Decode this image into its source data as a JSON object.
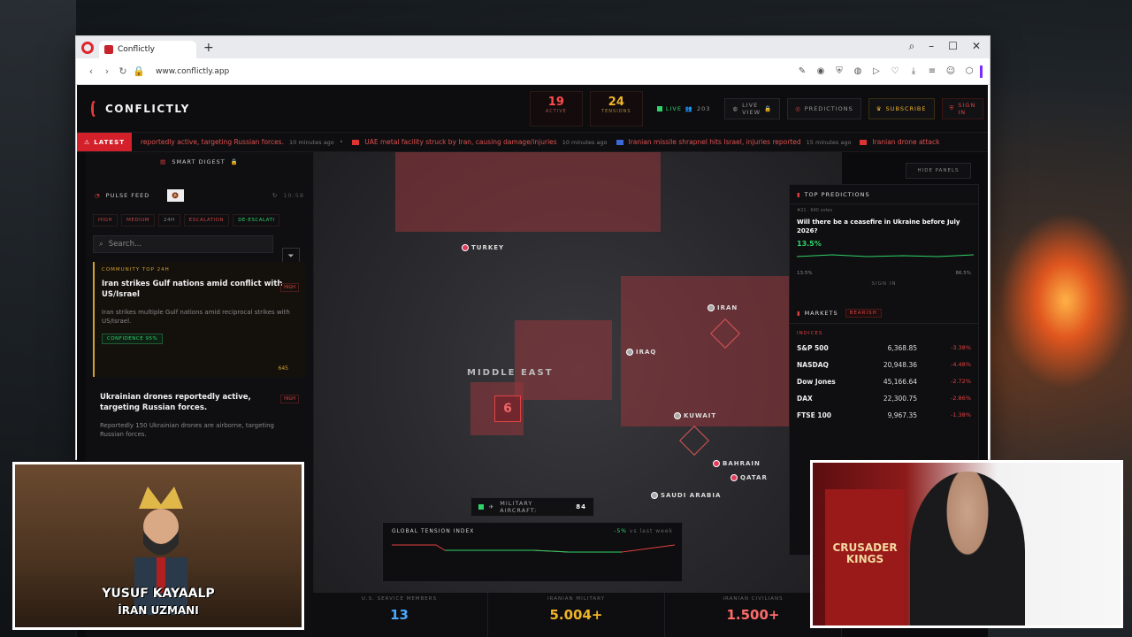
{
  "browser": {
    "tab_title": "Conflictly",
    "url": "www.conflictly.app"
  },
  "app": {
    "brand": "CONFLICTLY",
    "stats": [
      {
        "value": "19",
        "label": "ACTIVE"
      },
      {
        "value": "24",
        "label": "TENSIONS"
      }
    ],
    "live_label": "LIVE",
    "viewers": "203",
    "live_view_label": "LIVE VIEW",
    "predictions_label": "PREDICTIONS",
    "subscribe_label": "SUBSCRIBE",
    "sign_in_label": "SIGN IN"
  },
  "ticker": {
    "latest_label": "LATEST",
    "items": [
      {
        "text": "reportedly active, targeting Russian forces.",
        "time": "10 minutes ago"
      },
      {
        "text": "UAE metal facility struck by Iran, causing damage/injuries",
        "time": "10 minutes ago"
      },
      {
        "text": "Iranian missile shrapnel hits Israel, injuries reported",
        "time": "15 minutes ago"
      },
      {
        "text": "Iranian drone attack",
        "time": ""
      }
    ]
  },
  "left_panel": {
    "smart_digest": "SMART DIGEST",
    "pulse_feed": "PULSE FEED",
    "time": "10:58",
    "filters": [
      "HIGH",
      "MEDIUM",
      "24H",
      "ESCALATION",
      "DE-ESCALATI"
    ],
    "search_placeholder": "Search...",
    "card1": {
      "tag": "COMMUNITY TOP 24H",
      "title": "Iran strikes Gulf nations amid conflict with US/Israel",
      "body": "Iran strikes multiple Gulf nations amid reciprocal strikes with US/Israel.",
      "confidence": "CONFIDENCE 95%",
      "badge": "HIGH",
      "votes": "645"
    },
    "card2": {
      "title": "Ukrainian drones reportedly active, targeting Russian forces.",
      "body": "Reportedly 150 Ukrainian drones are airborne, targeting Russian forces.",
      "badge": "HIGH"
    }
  },
  "map": {
    "region_title": "MIDDLE EAST",
    "cluster_count": "6",
    "countries": [
      "TURKEY",
      "IRAN",
      "IRAQ",
      "KUWAIT",
      "BAHRAIN",
      "QATAR",
      "SAUDI ARABIA"
    ],
    "military_label": "MILITARY AIRCRAFT:",
    "military_value": "84",
    "tension_label": "GLOBAL TENSION INDEX",
    "tension_delta": "-5%",
    "tension_compare": "vs last week"
  },
  "bottom_stats": [
    {
      "label": "U.S. SERVICE MEMBERS",
      "value": "13",
      "color": "#4aa8ff"
    },
    {
      "label": "IRANIAN MILITARY",
      "value": "5.004+",
      "color": "#f0b429"
    },
    {
      "label": "IRANIAN CIVILIANS",
      "value": "1.500+",
      "color": "#ff6b6b"
    }
  ],
  "right_panel": {
    "hide_panels": "HIDE PANELS",
    "top_predictions": "TOP PREDICTIONS",
    "question": "Will there be a ceasefire in Ukraine before July 2026?",
    "meta": "#21 · 640 votes",
    "pct": "13.5%",
    "low": "13.5%",
    "high": "86.5%",
    "sign_in": "SIGN IN",
    "markets_label": "MARKETS",
    "bearish": "BEARISH",
    "indices_label": "INDICES",
    "markets": [
      {
        "name": "S&P 500",
        "price": "6,368.85",
        "chg": "-3.38%"
      },
      {
        "name": "NASDAQ",
        "price": "20,948.36",
        "chg": "-4.48%"
      },
      {
        "name": "Dow Jones",
        "price": "45,166.64",
        "chg": "-2.72%"
      },
      {
        "name": "DAX",
        "price": "22,300.75",
        "chg": "-2.86%"
      },
      {
        "name": "FTSE 100",
        "price": "9,967.35",
        "chg": "-1.38%"
      }
    ]
  },
  "overlay": {
    "name1": "YUSUF KAYAALP",
    "name2": "İRAN UZMANI",
    "banner": "CRUSADER KINGS"
  }
}
